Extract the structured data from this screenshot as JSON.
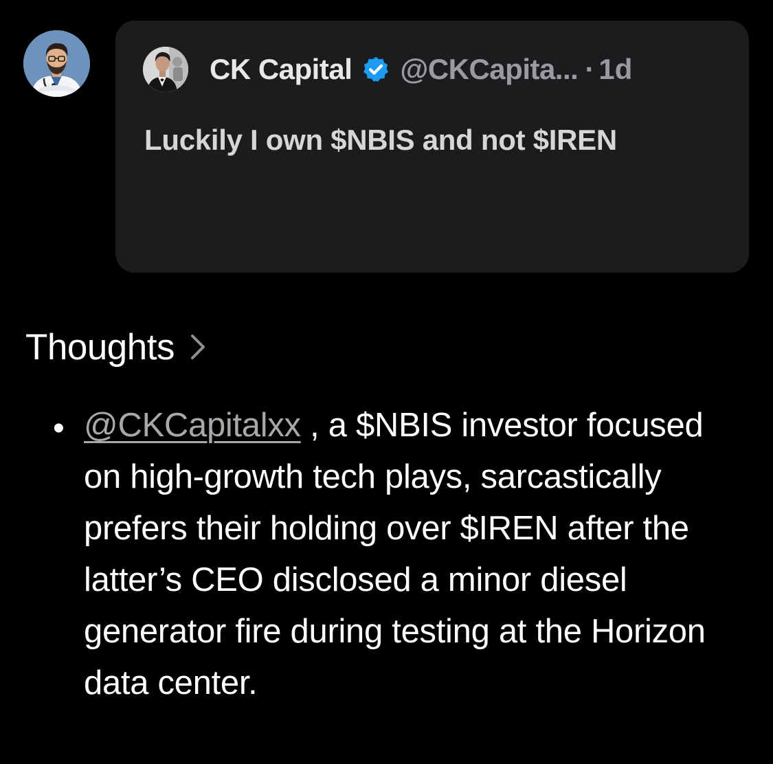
{
  "colors": {
    "background": "#000000",
    "card": "#1c1c1e",
    "verified": "#1d9bf0",
    "muted_text": "#9a9aa0"
  },
  "user": {
    "avatar_icon": "doctor-cartoon-avatar"
  },
  "quoted_post": {
    "avatar_icon": "tuxedo-man-avatar",
    "author_name": "CK Capital",
    "verified_icon": "verified-badge-icon",
    "handle": "@CKCapita...",
    "separator": "·",
    "age": "1d",
    "text": "Luckily I own $NBIS and not $IREN"
  },
  "thoughts": {
    "heading": "Thoughts",
    "chevron_icon": "chevron-right-icon",
    "bullet": "•",
    "mention": "@CKCapitalxx",
    "summary": " , a $NBIS investor focused on high-growth tech plays, sarcastically prefers their holding over $IREN after the latter’s CEO disclosed a minor diesel generator fire during testing at the Horizon data center."
  }
}
